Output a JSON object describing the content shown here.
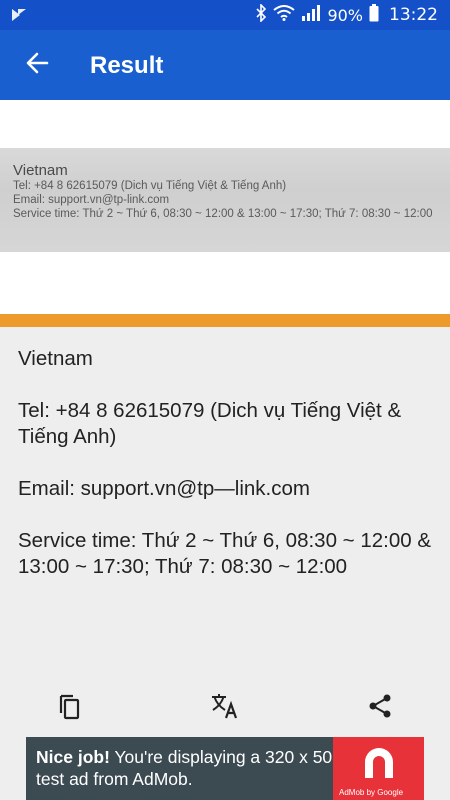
{
  "status_bar": {
    "battery": "90%",
    "time": "13:22",
    "icons": [
      "notification-icon",
      "bluetooth-icon",
      "wifi-icon",
      "signal-icon",
      "battery-icon"
    ]
  },
  "app_bar": {
    "title": "Result",
    "back_icon": "arrow-back-icon"
  },
  "scanned_image": {
    "title": "Vietnam",
    "lines": [
      "Tel: +84 8 62615079 (Dich vụ Tiếng Việt & Tiếng Anh)",
      "Email: support.vn@tp-link.com",
      "Service time: Thứ 2 ~ Thứ 6, 08:30 ~ 12:00 & 13:00 ~ 17:30;  Thứ 7: 08:30 ~ 12:00"
    ]
  },
  "result": {
    "paragraphs": [
      "Vietnam",
      "Tel: +84 8 62615079 (Dich vụ Tiếng Việt & Tiếng Anh)",
      "Email: support.vn@tp—link.com",
      "Service time: Thứ 2 ~ Thứ 6, 08:30 ~ 12:00 & 13:00 ~ 17:30; Thứ 7: 08:30 ~ 12:00"
    ]
  },
  "actions": {
    "copy_icon": "copy-icon",
    "translate_icon": "translate-icon",
    "share_icon": "share-icon"
  },
  "ad": {
    "headline": "Nice job!",
    "body": " You're displaying a 320 x 50 test ad from AdMob.",
    "caption": "AdMob by Google"
  },
  "colors": {
    "status_bar": "#1450c8",
    "app_bar": "#1a5fd0",
    "divider": "#ec9a2c",
    "ad_background": "#3c4a52",
    "ad_logo": "#e8323a"
  }
}
